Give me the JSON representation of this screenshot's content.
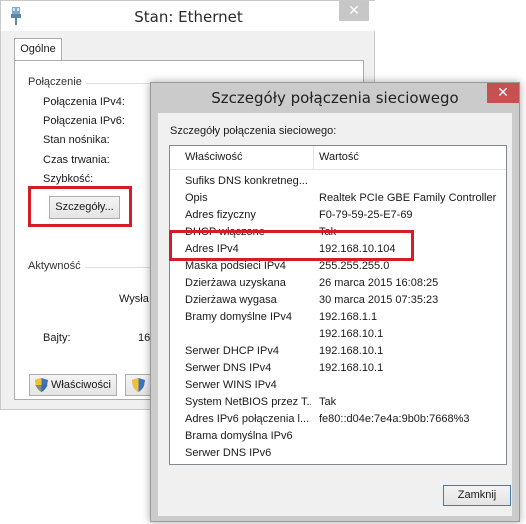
{
  "back_window": {
    "title": "Stan: Ethernet",
    "close_glyph": "✕",
    "tab_label": "Ogólne",
    "connection_group": "Połączenie",
    "fields": {
      "ipv4": "Połączenia IPv4:",
      "ipv6": "Połączenia IPv6:",
      "media": "Stan nośnika:",
      "duration": "Czas trwania:",
      "speed": "Szybkość:"
    },
    "details_button": "Szczegóły...",
    "activity_group": "Aktywność",
    "sent_label": "Wysła",
    "bytes_label": "Bajty:",
    "bytes_value": "16",
    "properties_button": "Właściwości"
  },
  "dialog": {
    "title": "Szczegóły połączenia sieciowego",
    "close_glyph": "✕",
    "caption": "Szczegóły połączenia sieciowego:",
    "columns": {
      "property": "Właściwość",
      "value": "Wartość"
    },
    "rows": [
      {
        "property": "Sufiks DNS konkretneg...",
        "value": ""
      },
      {
        "property": "Opis",
        "value": "Realtek PCIe GBE Family Controller"
      },
      {
        "property": "Adres fizyczny",
        "value": "F0-79-59-25-E7-69"
      },
      {
        "property": "DHCP włączone",
        "value": "Tak"
      },
      {
        "property": "Adres IPv4",
        "value": "192.168.10.104"
      },
      {
        "property": "Maska podsieci IPv4",
        "value": "255.255.255.0"
      },
      {
        "property": "Dzierżawa uzyskana",
        "value": "26 marca 2015 16:08:25"
      },
      {
        "property": "Dzierżawa wygasa",
        "value": "30 marca 2015 07:35:23"
      },
      {
        "property": "Bramy domyślne IPv4",
        "value": "192.168.1.1"
      },
      {
        "property": "",
        "value": "192.168.10.1"
      },
      {
        "property": "Serwer DHCP IPv4",
        "value": "192.168.10.1"
      },
      {
        "property": "Serwer DNS IPv4",
        "value": "192.168.10.1"
      },
      {
        "property": "Serwer WINS IPv4",
        "value": ""
      },
      {
        "property": "System NetBIOS przez T...",
        "value": "Tak"
      },
      {
        "property": "Adres IPv6 połączenia l...",
        "value": "fe80::d04e:7e4a:9b0b:7668%3"
      },
      {
        "property": "Brama domyślna IPv6",
        "value": ""
      },
      {
        "property": "Serwer DNS IPv6",
        "value": ""
      }
    ],
    "close_button": "Zamknij"
  },
  "colors": {
    "highlight_red": "#d21f25",
    "dialog_close_red": "#c75050"
  }
}
